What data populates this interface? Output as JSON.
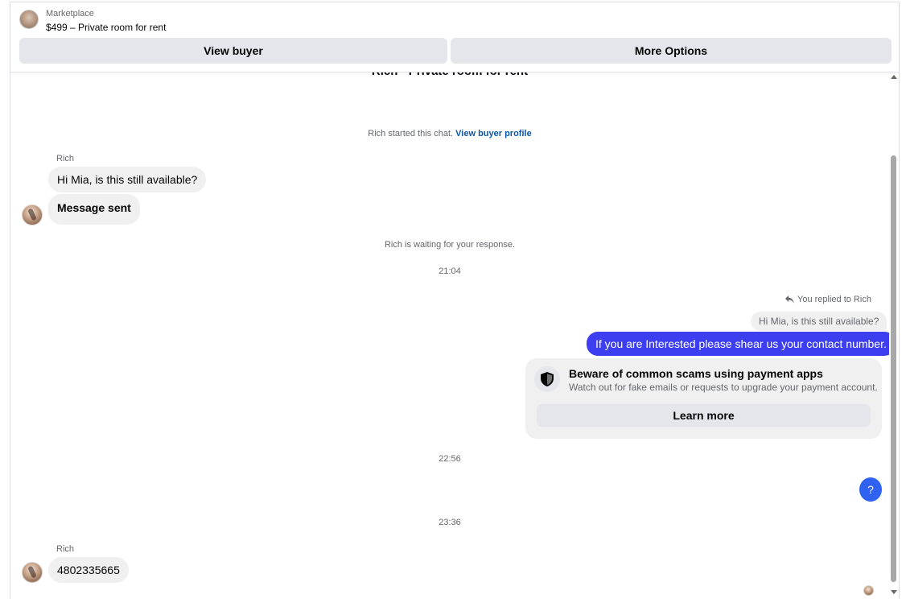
{
  "header": {
    "marketplace_label": "Marketplace",
    "listing_title": "$499 – Private room for rent",
    "view_buyer_label": "View buyer",
    "more_options_label": "More Options"
  },
  "thread": {
    "title": "Rich · Private room for rent",
    "started_text": "Rich started this chat.",
    "view_buyer_profile_link": "View buyer profile",
    "waiting_text": "Rich is waiting for your response."
  },
  "messages": {
    "sender_1": "Rich",
    "incoming_1": "Hi Mia, is this still available?",
    "incoming_2": "Message sent",
    "time_1": "21:04",
    "reply_label": "You replied to Rich",
    "reply_quote": "Hi Mia, is this still available?",
    "outgoing_1": "If you are Interested please shear us your contact number.",
    "time_2": "22:56",
    "outgoing_2": "?",
    "time_3": "23:36",
    "sender_2": "Rich",
    "incoming_3": "4802335665"
  },
  "scam_warning": {
    "title": "Beware of common scams using payment apps",
    "text": "Watch out for fake emails or requests to upgrade your payment account.",
    "button_label": "Learn more"
  },
  "colors": {
    "outgoing_bubble": "#3c3ef0",
    "link": "#0a58a8",
    "incoming_bubble": "#f0f0f0"
  }
}
